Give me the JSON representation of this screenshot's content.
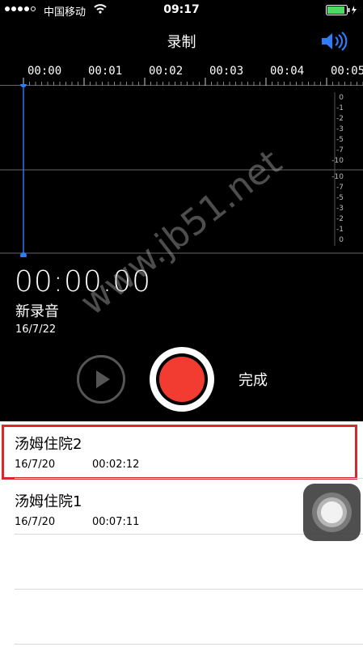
{
  "status_bar": {
    "carrier": "中国移动",
    "time": "09:17"
  },
  "nav": {
    "title": "录制",
    "speaker_icon": "speaker-volume-icon"
  },
  "timeline": {
    "labels": [
      "00:00",
      "00:01",
      "00:02",
      "00:03",
      "00:04",
      "00:05"
    ]
  },
  "waveform": {
    "db_top": [
      "0",
      "-1",
      "-2",
      "-3",
      "-5",
      "-7",
      "-10"
    ],
    "db_bottom": [
      "-10",
      "-7",
      "-5",
      "-3",
      "-2",
      "-1",
      "0"
    ]
  },
  "recording": {
    "elapsed": "00:00.00",
    "name": "新录音",
    "date": "16/7/22"
  },
  "controls": {
    "done_label": "完成",
    "play_icon": "play-circle-icon",
    "record_icon": "record-icon"
  },
  "watermark": "www.jb51.net",
  "recordings": [
    {
      "name": "汤姆住院2",
      "date": "16/7/20",
      "duration": "00:02:12"
    },
    {
      "name": "汤姆住院1",
      "date": "16/7/20",
      "duration": "00:07:11"
    }
  ],
  "colors": {
    "record_red": "#f23b31",
    "accent_blue": "#2f7cf6",
    "highlight_red": "#d7292b"
  }
}
